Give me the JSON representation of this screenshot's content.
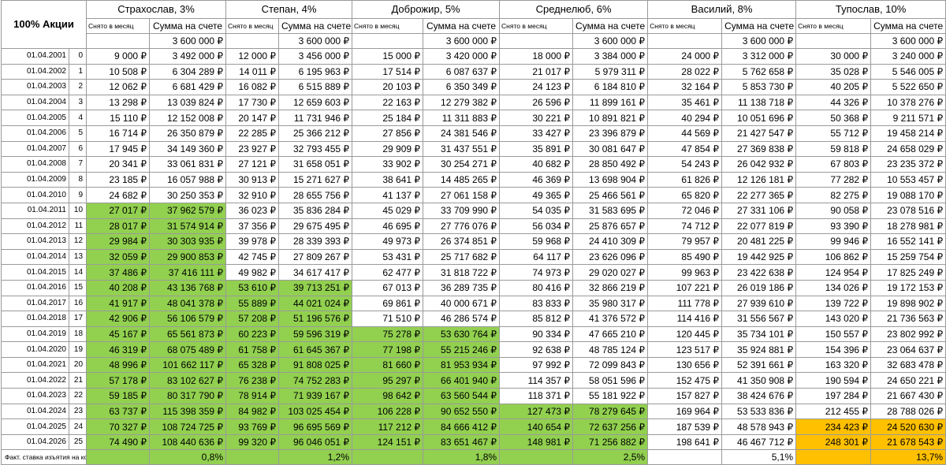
{
  "corner_label": "100% Акции",
  "sub_withdrawn": "Снято в месяц",
  "sub_balance": "Сумма на счете",
  "footer_label": "Факт. ставка изъятия на конец периода",
  "persons": [
    {
      "name": "Страхослав, 3%",
      "initial": "3 600 000 ₽",
      "rate": "0,8%"
    },
    {
      "name": "Степан, 4%",
      "initial": "3 600 000 ₽",
      "rate": "1,2%"
    },
    {
      "name": "Доброжир, 5%",
      "initial": "3 600 000 ₽",
      "rate": "1,8%"
    },
    {
      "name": "Среднелюб, 6%",
      "initial": "3 600 000 ₽",
      "rate": "2,5%"
    },
    {
      "name": "Василий, 8%",
      "initial": "3 600 000 ₽",
      "rate": "5,1%"
    },
    {
      "name": "Тупослав, 10%",
      "initial": "3 600 000 ₽",
      "rate": "13,7%"
    }
  ],
  "highlight_colors": {
    "green": "#92d050",
    "orange": "#ffc000"
  },
  "rows": [
    {
      "date": "01.04.2001",
      "idx": "0",
      "cells": [
        [
          "9 000 ₽",
          "3 492 000 ₽"
        ],
        [
          "12 000 ₽",
          "3 456 000 ₽"
        ],
        [
          "15 000 ₽",
          "3 420 000 ₽"
        ],
        [
          "18 000 ₽",
          "3 384 000 ₽"
        ],
        [
          "24 000 ₽",
          "3 312 000 ₽"
        ],
        [
          "30 000 ₽",
          "3 240 000 ₽"
        ]
      ]
    },
    {
      "date": "01.04.2002",
      "idx": "1",
      "cells": [
        [
          "10 508 ₽",
          "6 304 289 ₽"
        ],
        [
          "14 011 ₽",
          "6 195 963 ₽"
        ],
        [
          "17 514 ₽",
          "6 087 637 ₽"
        ],
        [
          "21 017 ₽",
          "5 979 311 ₽"
        ],
        [
          "28 022 ₽",
          "5 762 658 ₽"
        ],
        [
          "35 028 ₽",
          "5 546 005 ₽"
        ]
      ]
    },
    {
      "date": "01.04.2003",
      "idx": "2",
      "cells": [
        [
          "12 062 ₽",
          "6 681 429 ₽"
        ],
        [
          "16 082 ₽",
          "6 515 889 ₽"
        ],
        [
          "20 103 ₽",
          "6 350 349 ₽"
        ],
        [
          "24 123 ₽",
          "6 184 810 ₽"
        ],
        [
          "32 164 ₽",
          "5 853 730 ₽"
        ],
        [
          "40 205 ₽",
          "5 522 650 ₽"
        ]
      ]
    },
    {
      "date": "01.04.2004",
      "idx": "3",
      "cells": [
        [
          "13 298 ₽",
          "13 039 824 ₽"
        ],
        [
          "17 730 ₽",
          "12 659 603 ₽"
        ],
        [
          "22 163 ₽",
          "12 279 382 ₽"
        ],
        [
          "26 596 ₽",
          "11 899 161 ₽"
        ],
        [
          "35 461 ₽",
          "11 138 718 ₽"
        ],
        [
          "44 326 ₽",
          "10 378 276 ₽"
        ]
      ]
    },
    {
      "date": "01.04.2005",
      "idx": "4",
      "cells": [
        [
          "15 110 ₽",
          "12 152 008 ₽"
        ],
        [
          "20 147 ₽",
          "11 731 946 ₽"
        ],
        [
          "25 184 ₽",
          "11 311 883 ₽"
        ],
        [
          "30 221 ₽",
          "10 891 821 ₽"
        ],
        [
          "40 294 ₽",
          "10 051 696 ₽"
        ],
        [
          "50 368 ₽",
          "9 211 571 ₽"
        ]
      ]
    },
    {
      "date": "01.04.2006",
      "idx": "5",
      "cells": [
        [
          "16 714 ₽",
          "26 350 879 ₽"
        ],
        [
          "22 285 ₽",
          "25 366 212 ₽"
        ],
        [
          "27 856 ₽",
          "24 381 546 ₽"
        ],
        [
          "33 427 ₽",
          "23 396 879 ₽"
        ],
        [
          "44 569 ₽",
          "21 427 547 ₽"
        ],
        [
          "55 712 ₽",
          "19 458 214 ₽"
        ]
      ]
    },
    {
      "date": "01.04.2007",
      "idx": "6",
      "cells": [
        [
          "17 945 ₽",
          "34 149 360 ₽"
        ],
        [
          "23 927 ₽",
          "32 793 455 ₽"
        ],
        [
          "29 909 ₽",
          "31 437 551 ₽"
        ],
        [
          "35 891 ₽",
          "30 081 647 ₽"
        ],
        [
          "47 854 ₽",
          "27 369 838 ₽"
        ],
        [
          "59 818 ₽",
          "24 658 029 ₽"
        ]
      ]
    },
    {
      "date": "01.04.2008",
      "idx": "7",
      "cells": [
        [
          "20 341 ₽",
          "33 061 831 ₽"
        ],
        [
          "27 121 ₽",
          "31 658 051 ₽"
        ],
        [
          "33 902 ₽",
          "30 254 271 ₽"
        ],
        [
          "40 682 ₽",
          "28 850 492 ₽"
        ],
        [
          "54 243 ₽",
          "26 042 932 ₽"
        ],
        [
          "67 803 ₽",
          "23 235 372 ₽"
        ]
      ]
    },
    {
      "date": "01.04.2009",
      "idx": "8",
      "cells": [
        [
          "23 185 ₽",
          "16 057 988 ₽"
        ],
        [
          "30 913 ₽",
          "15 271 627 ₽"
        ],
        [
          "38 641 ₽",
          "14 485 265 ₽"
        ],
        [
          "46 369 ₽",
          "13 698 904 ₽"
        ],
        [
          "61 826 ₽",
          "12 126 181 ₽"
        ],
        [
          "77 282 ₽",
          "10 553 457 ₽"
        ]
      ]
    },
    {
      "date": "01.04.2010",
      "idx": "9",
      "cells": [
        [
          "24 682 ₽",
          "30 250 353 ₽"
        ],
        [
          "32 910 ₽",
          "28 655 756 ₽"
        ],
        [
          "41 137 ₽",
          "27 061 158 ₽"
        ],
        [
          "49 365 ₽",
          "25 466 561 ₽"
        ],
        [
          "65 820 ₽",
          "22 277 365 ₽"
        ],
        [
          "82 275 ₽",
          "19 088 170 ₽"
        ]
      ]
    },
    {
      "date": "01.04.2011",
      "idx": "10",
      "cells": [
        [
          "27 017 ₽",
          "37 962 579 ₽"
        ],
        [
          "36 023 ₽",
          "35 836 284 ₽"
        ],
        [
          "45 029 ₽",
          "33 709 990 ₽"
        ],
        [
          "54 035 ₽",
          "31 583 695 ₽"
        ],
        [
          "72 046 ₽",
          "27 331 106 ₽"
        ],
        [
          "90 058 ₽",
          "23 078 516 ₽"
        ]
      ]
    },
    {
      "date": "01.04.2012",
      "idx": "11",
      "cells": [
        [
          "28 017 ₽",
          "31 574 914 ₽"
        ],
        [
          "37 356 ₽",
          "29 675 495 ₽"
        ],
        [
          "46 695 ₽",
          "27 776 076 ₽"
        ],
        [
          "56 034 ₽",
          "25 876 657 ₽"
        ],
        [
          "74 712 ₽",
          "22 077 819 ₽"
        ],
        [
          "93 390 ₽",
          "18 278 981 ₽"
        ]
      ]
    },
    {
      "date": "01.04.2013",
      "idx": "12",
      "cells": [
        [
          "29 984 ₽",
          "30 303 935 ₽"
        ],
        [
          "39 978 ₽",
          "28 339 393 ₽"
        ],
        [
          "49 973 ₽",
          "26 374 851 ₽"
        ],
        [
          "59 968 ₽",
          "24 410 309 ₽"
        ],
        [
          "79 957 ₽",
          "20 481 225 ₽"
        ],
        [
          "99 946 ₽",
          "16 552 141 ₽"
        ]
      ]
    },
    {
      "date": "01.04.2014",
      "idx": "13",
      "cells": [
        [
          "32 059 ₽",
          "29 900 853 ₽"
        ],
        [
          "42 745 ₽",
          "27 809 267 ₽"
        ],
        [
          "53 431 ₽",
          "25 717 682 ₽"
        ],
        [
          "64 117 ₽",
          "23 626 096 ₽"
        ],
        [
          "85 490 ₽",
          "19 442 925 ₽"
        ],
        [
          "106 862 ₽",
          "15 259 754 ₽"
        ]
      ]
    },
    {
      "date": "01.04.2015",
      "idx": "14",
      "cells": [
        [
          "37 486 ₽",
          "37 416 111 ₽"
        ],
        [
          "49 982 ₽",
          "34 617 417 ₽"
        ],
        [
          "62 477 ₽",
          "31 818 722 ₽"
        ],
        [
          "74 973 ₽",
          "29 020 027 ₽"
        ],
        [
          "99 963 ₽",
          "23 422 638 ₽"
        ],
        [
          "124 954 ₽",
          "17 825 249 ₽"
        ]
      ]
    },
    {
      "date": "01.04.2016",
      "idx": "15",
      "cells": [
        [
          "40 208 ₽",
          "43 136 768 ₽"
        ],
        [
          "53 610 ₽",
          "39 713 251 ₽"
        ],
        [
          "67 013 ₽",
          "36 289 735 ₽"
        ],
        [
          "80 416 ₽",
          "32 866 219 ₽"
        ],
        [
          "107 221 ₽",
          "26 019 186 ₽"
        ],
        [
          "134 026 ₽",
          "19 172 153 ₽"
        ]
      ]
    },
    {
      "date": "01.04.2017",
      "idx": "16",
      "cells": [
        [
          "41 917 ₽",
          "48 041 378 ₽"
        ],
        [
          "55 889 ₽",
          "44 021 024 ₽"
        ],
        [
          "69 861 ₽",
          "40 000 671 ₽"
        ],
        [
          "83 833 ₽",
          "35 980 317 ₽"
        ],
        [
          "111 778 ₽",
          "27 939 610 ₽"
        ],
        [
          "139 722 ₽",
          "19 898 902 ₽"
        ]
      ]
    },
    {
      "date": "01.04.2018",
      "idx": "17",
      "cells": [
        [
          "42 906 ₽",
          "56 106 579 ₽"
        ],
        [
          "57 208 ₽",
          "51 196 576 ₽"
        ],
        [
          "71 510 ₽",
          "46 286 574 ₽"
        ],
        [
          "85 812 ₽",
          "41 376 572 ₽"
        ],
        [
          "114 416 ₽",
          "31 556 567 ₽"
        ],
        [
          "143 020 ₽",
          "21 736 563 ₽"
        ]
      ]
    },
    {
      "date": "01.04.2019",
      "idx": "18",
      "cells": [
        [
          "45 167 ₽",
          "65 561 873 ₽"
        ],
        [
          "60 223 ₽",
          "59 596 319 ₽"
        ],
        [
          "75 278 ₽",
          "53 630 764 ₽"
        ],
        [
          "90 334 ₽",
          "47 665 210 ₽"
        ],
        [
          "120 445 ₽",
          "35 734 101 ₽"
        ],
        [
          "150 557 ₽",
          "23 802 992 ₽"
        ]
      ]
    },
    {
      "date": "01.04.2020",
      "idx": "19",
      "cells": [
        [
          "46 319 ₽",
          "68 075 489 ₽"
        ],
        [
          "61 758 ₽",
          "61 645 367 ₽"
        ],
        [
          "77 198 ₽",
          "55 215 246 ₽"
        ],
        [
          "92 638 ₽",
          "48 785 124 ₽"
        ],
        [
          "123 517 ₽",
          "35 924 881 ₽"
        ],
        [
          "154 396 ₽",
          "23 064 637 ₽"
        ]
      ]
    },
    {
      "date": "01.04.2021",
      "idx": "20",
      "cells": [
        [
          "48 996 ₽",
          "101 662 117 ₽"
        ],
        [
          "65 328 ₽",
          "91 808 025 ₽"
        ],
        [
          "81 660 ₽",
          "81 953 934 ₽"
        ],
        [
          "97 992 ₽",
          "72 099 843 ₽"
        ],
        [
          "130 656 ₽",
          "52 391 661 ₽"
        ],
        [
          "163 320 ₽",
          "32 683 478 ₽"
        ]
      ]
    },
    {
      "date": "01.04.2022",
      "idx": "21",
      "cells": [
        [
          "57 178 ₽",
          "83 102 627 ₽"
        ],
        [
          "76 238 ₽",
          "74 752 283 ₽"
        ],
        [
          "95 297 ₽",
          "66 401 940 ₽"
        ],
        [
          "114 357 ₽",
          "58 051 596 ₽"
        ],
        [
          "152 475 ₽",
          "41 350 908 ₽"
        ],
        [
          "190 594 ₽",
          "24 650 221 ₽"
        ]
      ]
    },
    {
      "date": "01.04.2023",
      "idx": "22",
      "cells": [
        [
          "59 185 ₽",
          "80 317 790 ₽"
        ],
        [
          "78 914 ₽",
          "71 939 167 ₽"
        ],
        [
          "98 642 ₽",
          "63 560 544 ₽"
        ],
        [
          "118 371 ₽",
          "55 181 922 ₽"
        ],
        [
          "157 827 ₽",
          "38 424 676 ₽"
        ],
        [
          "197 284 ₽",
          "21 667 430 ₽"
        ]
      ]
    },
    {
      "date": "01.04.2024",
      "idx": "23",
      "cells": [
        [
          "63 737 ₽",
          "115 398 359 ₽"
        ],
        [
          "84 982 ₽",
          "103 025 454 ₽"
        ],
        [
          "106 228 ₽",
          "90 652 550 ₽"
        ],
        [
          "127 473 ₽",
          "78 279 645 ₽"
        ],
        [
          "169 964 ₽",
          "53 533 836 ₽"
        ],
        [
          "212 455 ₽",
          "28 788 026 ₽"
        ]
      ]
    },
    {
      "date": "01.04.2025",
      "idx": "24",
      "cells": [
        [
          "70 327 ₽",
          "108 724 725 ₽"
        ],
        [
          "93 769 ₽",
          "96 695 569 ₽"
        ],
        [
          "117 212 ₽",
          "84 666 412 ₽"
        ],
        [
          "140 654 ₽",
          "72 637 256 ₽"
        ],
        [
          "187 539 ₽",
          "48 578 943 ₽"
        ],
        [
          "234 423 ₽",
          "24 520 630 ₽"
        ]
      ]
    },
    {
      "date": "01.04.2026",
      "idx": "25",
      "cells": [
        [
          "74 490 ₽",
          "108 440 636 ₽"
        ],
        [
          "99 320 ₽",
          "96 046 051 ₽"
        ],
        [
          "124 151 ₽",
          "83 651 467 ₽"
        ],
        [
          "148 981 ₽",
          "71 256 882 ₽"
        ],
        [
          "198 641 ₽",
          "46 467 712 ₽"
        ],
        [
          "248 301 ₽",
          "21 678 543 ₽"
        ]
      ]
    }
  ],
  "highlight_start_row": [
    "10",
    "15",
    "18",
    "23",
    "",
    ""
  ],
  "orange_rows": [
    "24",
    "25"
  ]
}
